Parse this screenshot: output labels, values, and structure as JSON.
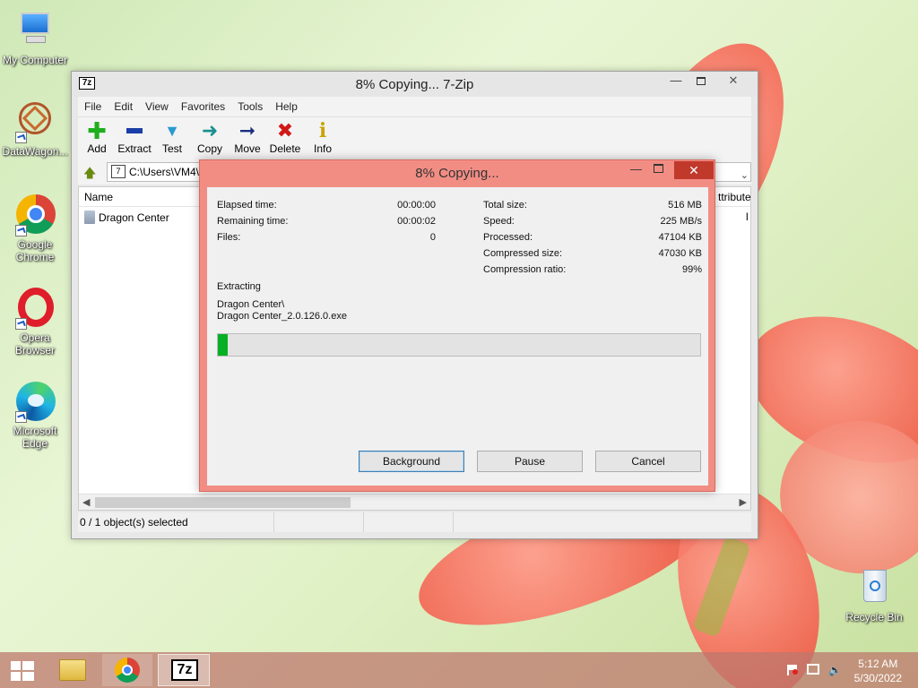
{
  "desktop": {
    "icons": [
      {
        "label": "My Computer"
      },
      {
        "label": "DataWagon..."
      },
      {
        "label": "Google Chrome"
      },
      {
        "label": "Opera Browser"
      },
      {
        "label": "Microsoft Edge"
      },
      {
        "label": "Recycle Bin"
      }
    ]
  },
  "main_window": {
    "icon_text": "7z",
    "title": "8% Copying... 7-Zip",
    "menu": [
      "File",
      "Edit",
      "View",
      "Favorites",
      "Tools",
      "Help"
    ],
    "toolbar": [
      {
        "label": "Add",
        "icon": "plus-icon",
        "color": "#1fae1f"
      },
      {
        "label": "Extract",
        "icon": "minus-icon",
        "color": "#1a3ea8"
      },
      {
        "label": "Test",
        "icon": "check-icon",
        "color": "#2a9ad0"
      },
      {
        "label": "Copy",
        "icon": "copy-arrow-icon",
        "color": "#1b8f8f"
      },
      {
        "label": "Move",
        "icon": "move-arrow-icon",
        "color": "#1a2f80"
      },
      {
        "label": "Delete",
        "icon": "delete-x-icon",
        "color": "#d01818"
      },
      {
        "label": "Info",
        "icon": "info-icon",
        "color": "#c8a400"
      }
    ],
    "address": "C:\\Users\\VM4\\",
    "columns": {
      "name": "Name",
      "attributes": "ttribute"
    },
    "items": [
      "Dragon Center"
    ],
    "column_fragment": "l",
    "status": "0 / 1 object(s) selected"
  },
  "dialog": {
    "title": "8% Copying...",
    "elapsed_label": "Elapsed time:",
    "elapsed_value": "00:00:00",
    "remaining_label": "Remaining time:",
    "remaining_value": "00:00:02",
    "files_label": "Files:",
    "files_value": "0",
    "total_label": "Total size:",
    "total_value": "516 MB",
    "speed_label": "Speed:",
    "speed_value": "225 MB/s",
    "processed_label": "Processed:",
    "processed_value": "47104 KB",
    "compressed_label": "Compressed size:",
    "compressed_value": "47030 KB",
    "ratio_label": "Compression ratio:",
    "ratio_value": "99%",
    "operation": "Extracting",
    "path_line1": "Dragon Center\\",
    "path_line2": "Dragon Center_2.0.126.0.exe",
    "progress": 0.02,
    "progress_color": "#06b025",
    "buttons": {
      "background": "Background",
      "pause": "Pause",
      "cancel": "Cancel"
    }
  },
  "taskbar": {
    "clock_time": "5:12 AM",
    "clock_date": "5/30/2022"
  }
}
